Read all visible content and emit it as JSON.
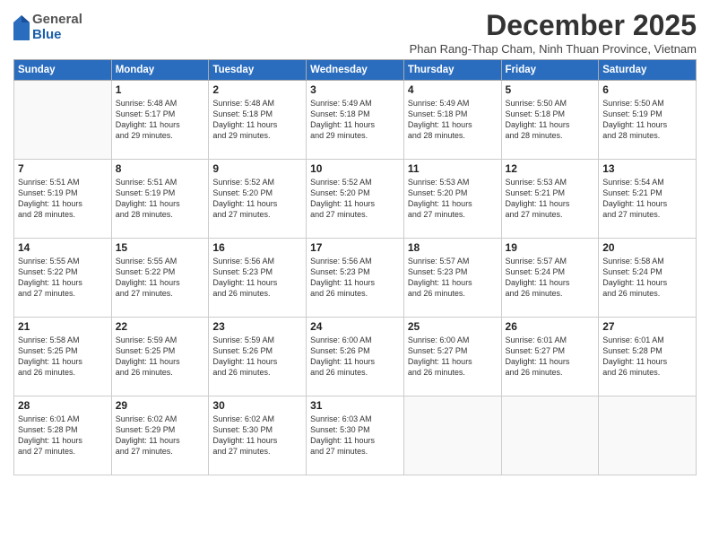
{
  "logo": {
    "general": "General",
    "blue": "Blue"
  },
  "title": "December 2025",
  "subtitle": "Phan Rang-Thap Cham, Ninh Thuan Province, Vietnam",
  "headers": [
    "Sunday",
    "Monday",
    "Tuesday",
    "Wednesday",
    "Thursday",
    "Friday",
    "Saturday"
  ],
  "weeks": [
    [
      {
        "day": "",
        "info": ""
      },
      {
        "day": "1",
        "info": "Sunrise: 5:48 AM\nSunset: 5:17 PM\nDaylight: 11 hours\nand 29 minutes."
      },
      {
        "day": "2",
        "info": "Sunrise: 5:48 AM\nSunset: 5:18 PM\nDaylight: 11 hours\nand 29 minutes."
      },
      {
        "day": "3",
        "info": "Sunrise: 5:49 AM\nSunset: 5:18 PM\nDaylight: 11 hours\nand 29 minutes."
      },
      {
        "day": "4",
        "info": "Sunrise: 5:49 AM\nSunset: 5:18 PM\nDaylight: 11 hours\nand 28 minutes."
      },
      {
        "day": "5",
        "info": "Sunrise: 5:50 AM\nSunset: 5:18 PM\nDaylight: 11 hours\nand 28 minutes."
      },
      {
        "day": "6",
        "info": "Sunrise: 5:50 AM\nSunset: 5:19 PM\nDaylight: 11 hours\nand 28 minutes."
      }
    ],
    [
      {
        "day": "7",
        "info": "Sunrise: 5:51 AM\nSunset: 5:19 PM\nDaylight: 11 hours\nand 28 minutes."
      },
      {
        "day": "8",
        "info": "Sunrise: 5:51 AM\nSunset: 5:19 PM\nDaylight: 11 hours\nand 28 minutes."
      },
      {
        "day": "9",
        "info": "Sunrise: 5:52 AM\nSunset: 5:20 PM\nDaylight: 11 hours\nand 27 minutes."
      },
      {
        "day": "10",
        "info": "Sunrise: 5:52 AM\nSunset: 5:20 PM\nDaylight: 11 hours\nand 27 minutes."
      },
      {
        "day": "11",
        "info": "Sunrise: 5:53 AM\nSunset: 5:20 PM\nDaylight: 11 hours\nand 27 minutes."
      },
      {
        "day": "12",
        "info": "Sunrise: 5:53 AM\nSunset: 5:21 PM\nDaylight: 11 hours\nand 27 minutes."
      },
      {
        "day": "13",
        "info": "Sunrise: 5:54 AM\nSunset: 5:21 PM\nDaylight: 11 hours\nand 27 minutes."
      }
    ],
    [
      {
        "day": "14",
        "info": "Sunrise: 5:55 AM\nSunset: 5:22 PM\nDaylight: 11 hours\nand 27 minutes."
      },
      {
        "day": "15",
        "info": "Sunrise: 5:55 AM\nSunset: 5:22 PM\nDaylight: 11 hours\nand 27 minutes."
      },
      {
        "day": "16",
        "info": "Sunrise: 5:56 AM\nSunset: 5:23 PM\nDaylight: 11 hours\nand 26 minutes."
      },
      {
        "day": "17",
        "info": "Sunrise: 5:56 AM\nSunset: 5:23 PM\nDaylight: 11 hours\nand 26 minutes."
      },
      {
        "day": "18",
        "info": "Sunrise: 5:57 AM\nSunset: 5:23 PM\nDaylight: 11 hours\nand 26 minutes."
      },
      {
        "day": "19",
        "info": "Sunrise: 5:57 AM\nSunset: 5:24 PM\nDaylight: 11 hours\nand 26 minutes."
      },
      {
        "day": "20",
        "info": "Sunrise: 5:58 AM\nSunset: 5:24 PM\nDaylight: 11 hours\nand 26 minutes."
      }
    ],
    [
      {
        "day": "21",
        "info": "Sunrise: 5:58 AM\nSunset: 5:25 PM\nDaylight: 11 hours\nand 26 minutes."
      },
      {
        "day": "22",
        "info": "Sunrise: 5:59 AM\nSunset: 5:25 PM\nDaylight: 11 hours\nand 26 minutes."
      },
      {
        "day": "23",
        "info": "Sunrise: 5:59 AM\nSunset: 5:26 PM\nDaylight: 11 hours\nand 26 minutes."
      },
      {
        "day": "24",
        "info": "Sunrise: 6:00 AM\nSunset: 5:26 PM\nDaylight: 11 hours\nand 26 minutes."
      },
      {
        "day": "25",
        "info": "Sunrise: 6:00 AM\nSunset: 5:27 PM\nDaylight: 11 hours\nand 26 minutes."
      },
      {
        "day": "26",
        "info": "Sunrise: 6:01 AM\nSunset: 5:27 PM\nDaylight: 11 hours\nand 26 minutes."
      },
      {
        "day": "27",
        "info": "Sunrise: 6:01 AM\nSunset: 5:28 PM\nDaylight: 11 hours\nand 26 minutes."
      }
    ],
    [
      {
        "day": "28",
        "info": "Sunrise: 6:01 AM\nSunset: 5:28 PM\nDaylight: 11 hours\nand 27 minutes."
      },
      {
        "day": "29",
        "info": "Sunrise: 6:02 AM\nSunset: 5:29 PM\nDaylight: 11 hours\nand 27 minutes."
      },
      {
        "day": "30",
        "info": "Sunrise: 6:02 AM\nSunset: 5:30 PM\nDaylight: 11 hours\nand 27 minutes."
      },
      {
        "day": "31",
        "info": "Sunrise: 6:03 AM\nSunset: 5:30 PM\nDaylight: 11 hours\nand 27 minutes."
      },
      {
        "day": "",
        "info": ""
      },
      {
        "day": "",
        "info": ""
      },
      {
        "day": "",
        "info": ""
      }
    ]
  ]
}
